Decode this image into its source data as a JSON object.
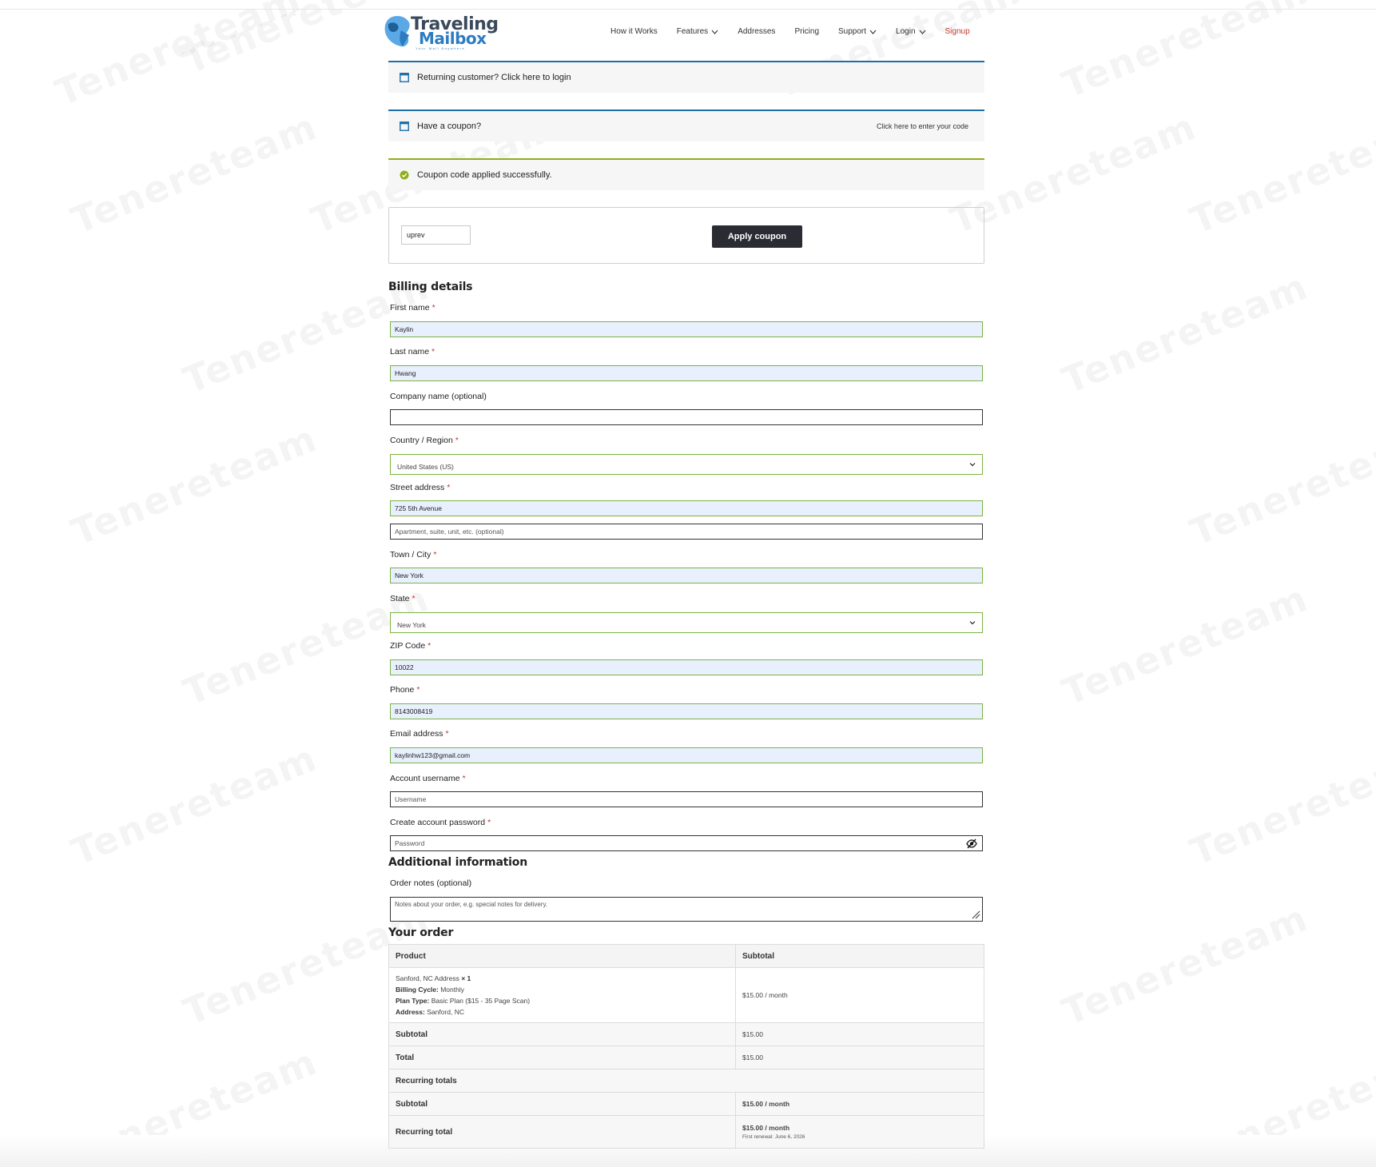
{
  "watermark": {
    "text": "Tenereteam"
  },
  "header": {
    "logo": {
      "line1": "Traveling",
      "line2": "Mailbox",
      "tagline": "Your Mail Anywhere"
    },
    "nav": {
      "how_it_works": "How it Works",
      "features": "Features",
      "addresses": "Addresses",
      "pricing": "Pricing",
      "support": "Support",
      "login": "Login",
      "signup": "Signup"
    }
  },
  "notices": {
    "returning": "Returning customer? Click here to login",
    "coupon_question": "Have a coupon?",
    "coupon_link": "Click here to enter your code",
    "coupon_success": "Coupon code applied successfully."
  },
  "coupon": {
    "value": "uprev",
    "apply_label": "Apply coupon"
  },
  "billing": {
    "heading": "Billing details",
    "first_name": {
      "label": "First name",
      "value": "Kaylin"
    },
    "last_name": {
      "label": "Last name",
      "value": "Hwang"
    },
    "company": {
      "label": "Company name (optional)",
      "value": ""
    },
    "country": {
      "label": "Country / Region",
      "value": "United States (US)"
    },
    "street": {
      "label": "Street address",
      "value": "725 5th Avenue",
      "placeholder2": "Apartment, suite, unit, etc. (optional)"
    },
    "city": {
      "label": "Town / City",
      "value": "New York"
    },
    "state": {
      "label": "State",
      "value": "New York"
    },
    "zip": {
      "label": "ZIP Code",
      "value": "10022"
    },
    "phone": {
      "label": "Phone",
      "value": "8143008419"
    },
    "email": {
      "label": "Email address",
      "value": "kaylinhw123@gmail.com"
    },
    "username": {
      "label": "Account username",
      "placeholder": "Username"
    },
    "password": {
      "label": "Create account password",
      "placeholder": "Password"
    },
    "required_mark": "*"
  },
  "additional": {
    "heading": "Additional information",
    "notes_label": "Order notes (optional)",
    "notes_placeholder": "Notes about your order, e.g. special notes for delivery."
  },
  "order": {
    "heading": "Your order",
    "col_product": "Product",
    "col_subtotal": "Subtotal",
    "item": {
      "name": "Sanford, NC Address",
      "qty": "× 1",
      "billing_cycle_label": "Billing Cycle:",
      "billing_cycle": "Monthly",
      "plan_type_label": "Plan Type:",
      "plan_type": "Basic Plan ($15 - 35 Page Scan)",
      "address_label": "Address:",
      "address": "Sanford, NC",
      "price": "$15.00 / month"
    },
    "subtotal_label": "Subtotal",
    "subtotal_value": "$15.00",
    "total_label": "Total",
    "total_value": "$15.00",
    "recurring_heading": "Recurring totals",
    "recurring_subtotal_label": "Subtotal",
    "recurring_subtotal_value": "$15.00 / month",
    "recurring_total_label": "Recurring total",
    "recurring_total_value": "$15.00 / month",
    "first_renewal": "First renewal: June 6, 2026"
  },
  "colors": {
    "accent_blue": "#1e6fa8",
    "success_green": "#8fae1b",
    "required_red": "#c0392b",
    "button_dark": "#2b2b33",
    "autofill_bg": "#e8f0fe"
  }
}
